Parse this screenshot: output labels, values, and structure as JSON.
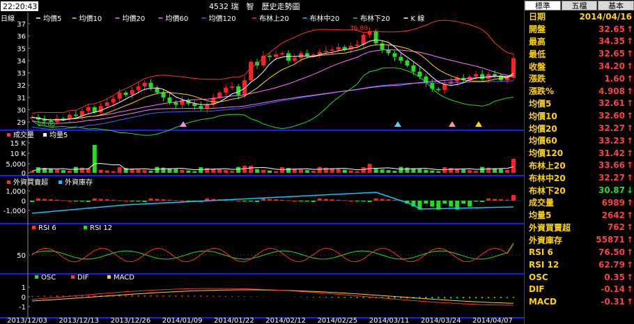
{
  "header": {
    "clock": "22:20:43",
    "title": "4532 瑞　智　歷史走勢圖",
    "period_label": "日線",
    "legend": [
      {
        "label": "均價5",
        "color": "#ffffff"
      },
      {
        "label": "均價10",
        "color": "#ffd400"
      },
      {
        "label": "均價20",
        "color": "#ff77ff"
      },
      {
        "label": "均價60",
        "color": "#ff77ff"
      },
      {
        "label": "均價120",
        "color": "#4466ff"
      },
      {
        "label": "布林上20",
        "color": "#ff3030"
      },
      {
        "label": "布林中20",
        "color": "#00ccff"
      },
      {
        "label": "布林下20",
        "color": "#22dd22"
      },
      {
        "label": "K 線",
        "color": "#ffffff"
      }
    ]
  },
  "price_panel": {
    "y_ticks": [
      "37",
      "36",
      "35",
      "34",
      "33",
      "32",
      "31",
      "30",
      "29"
    ],
    "high_label": "36.80",
    "low_label": "28.85"
  },
  "volume_panel": {
    "legend": [
      {
        "label": "成交量",
        "color": "#ff3030"
      },
      {
        "label": "均量5",
        "color": "#ffffff"
      }
    ],
    "y_ticks": [
      "15 K",
      "10 K",
      "5,000",
      "0"
    ]
  },
  "foreign_panel": {
    "legend": [
      {
        "label": "外資買賣超",
        "color": "#ff3030"
      },
      {
        "label": "外資庫存",
        "color": "#00ccff"
      }
    ],
    "y_ticks": [
      "1,000",
      "0",
      "-1,000"
    ]
  },
  "rsi_panel": {
    "legend": [
      {
        "label": "RSI 6",
        "color": "#ff3030"
      },
      {
        "label": "RSI 12",
        "color": "#22dd22"
      }
    ],
    "y_ticks": [
      "50"
    ]
  },
  "macd_panel": {
    "legend": [
      {
        "label": "OSC",
        "color": "#22dd22"
      },
      {
        "label": "DIF",
        "color": "#ff3030"
      },
      {
        "label": "MACD",
        "color": "#ffd400"
      }
    ],
    "y_ticks": [
      "1",
      "0",
      "-1"
    ]
  },
  "x_axis": [
    "2013/12/03",
    "2013/12/13",
    "2013/12/26",
    "2014/01/09",
    "2014/01/22",
    "2014/02/12",
    "2014/02/25",
    "2014/03/11",
    "2014/03/24",
    "2014/04/07"
  ],
  "quote": {
    "tabs": [
      {
        "label": "標準",
        "active": true
      },
      {
        "label": "五檔",
        "active": false
      },
      {
        "label": "基本",
        "active": false
      }
    ],
    "rows": [
      {
        "label": "日期",
        "value": "2014/04/16",
        "arrow": "",
        "style": "date"
      },
      {
        "label": "開盤",
        "value": "32.65",
        "arrow": "↑",
        "style": "up"
      },
      {
        "label": "最高",
        "value": "34.35",
        "arrow": "↑",
        "style": "up"
      },
      {
        "label": "最低",
        "value": "32.65",
        "arrow": "↑",
        "style": "up"
      },
      {
        "label": "收盤",
        "value": "34.20",
        "arrow": "↑",
        "style": "up"
      },
      {
        "label": "漲跌",
        "value": "1.60",
        "arrow": "↑",
        "style": "up"
      },
      {
        "label": "漲跌%",
        "value": "4.908",
        "arrow": "↑",
        "style": "up"
      },
      {
        "label": "均價5",
        "value": "32.61",
        "arrow": "↑",
        "style": "up"
      },
      {
        "label": "均價10",
        "value": "32.60",
        "arrow": "↑",
        "style": "up"
      },
      {
        "label": "均價20",
        "value": "32.27",
        "arrow": "↑",
        "style": "up"
      },
      {
        "label": "均價60",
        "value": "33.23",
        "arrow": "↑",
        "style": "up"
      },
      {
        "label": "均價120",
        "value": "31.42",
        "arrow": "↑",
        "style": "up"
      },
      {
        "label": "布林上20",
        "value": "33.66",
        "arrow": "↑",
        "style": "up"
      },
      {
        "label": "布林中20",
        "value": "32.27",
        "arrow": "↑",
        "style": "up"
      },
      {
        "label": "布林下20",
        "value": "30.87",
        "arrow": "↓",
        "style": "green"
      },
      {
        "label": "成交量",
        "value": "6989",
        "arrow": "↑",
        "style": "up"
      },
      {
        "label": "均量5",
        "value": "2642",
        "arrow": "↑",
        "style": "up"
      },
      {
        "label": "外資買賣超",
        "value": "762",
        "arrow": "↑",
        "style": "up"
      },
      {
        "label": "外資庫存",
        "value": "55871",
        "arrow": "↑",
        "style": "up"
      },
      {
        "label": "RSI 6",
        "value": "76.50",
        "arrow": "↑",
        "style": "up"
      },
      {
        "label": "RSI 12",
        "value": "62.79",
        "arrow": "↑",
        "style": "up"
      },
      {
        "label": "OSC",
        "value": "0.35",
        "arrow": "↑",
        "style": "up"
      },
      {
        "label": "DIF",
        "value": "-0.14",
        "arrow": "↑",
        "style": "up"
      },
      {
        "label": "MACD",
        "value": "-0.31",
        "arrow": "↑",
        "style": "up"
      }
    ]
  },
  "chart_data": {
    "type": "candlestick",
    "symbol": "4532",
    "closes": [
      29.4,
      29.2,
      29.1,
      29.0,
      29.3,
      29.2,
      29.6,
      29.5,
      29.9,
      30.2,
      29.8,
      30.3,
      30.6,
      30.9,
      31.4,
      31.2,
      31.6,
      31.9,
      32.2,
      31.8,
      31.4,
      31.0,
      30.6,
      30.4,
      30.8,
      30.5,
      30.3,
      30.1,
      30.4,
      31.0,
      31.4,
      31.8,
      31.9,
      31.2,
      32.4,
      33.9,
      33.6,
      34.4,
      34.3,
      34.5,
      34.6,
      34.0,
      34.2,
      34.6,
      34.4,
      34.5,
      34.7,
      34.8,
      34.9,
      35.1,
      34.9,
      35.2,
      35.3,
      36.1,
      36.4,
      35.4,
      34.9,
      34.6,
      34.3,
      34.0,
      33.6,
      33.1,
      32.7,
      32.2,
      31.7,
      31.6,
      32.1,
      32.3,
      32.6,
      32.4,
      32.7,
      32.9,
      32.5,
      32.9,
      32.8,
      32.4,
      32.6,
      34.2
    ],
    "volume_y_range": [
      0,
      15000
    ],
    "foreign_y_range": [
      -1500,
      1500
    ],
    "rsi_y_range": [
      0,
      100
    ],
    "macd_y_range": [
      -1.5,
      1.5
    ],
    "price_y_range": [
      28.5,
      37
    ]
  }
}
